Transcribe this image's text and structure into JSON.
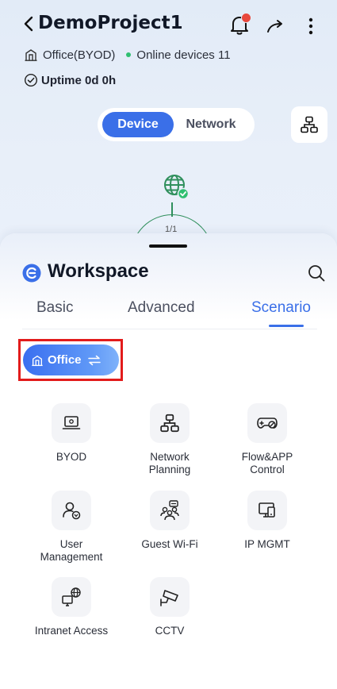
{
  "header": {
    "project_title": "DemoProject1",
    "site_name": "Office(BYOD)",
    "online_devices": "Online devices 11",
    "uptime": "Uptime 0d 0h"
  },
  "view_switch": {
    "device_label": "Device",
    "network_label": "Network",
    "selected": "Device"
  },
  "topology": {
    "page_count": "1/1"
  },
  "workspace": {
    "title": "Workspace",
    "tabs": [
      {
        "label": "Basic"
      },
      {
        "label": "Advanced"
      },
      {
        "label": "Scenario"
      }
    ],
    "active_tab": "Scenario",
    "scenario_selector": "Office",
    "features": [
      {
        "label": "BYOD",
        "icon": "byod-icon"
      },
      {
        "label": "Network\nPlanning",
        "icon": "network-planning-icon"
      },
      {
        "label": "Flow&APP\nControl",
        "icon": "flow-app-control-icon"
      },
      {
        "label": "User\nManagement",
        "icon": "user-management-icon"
      },
      {
        "label": "Guest Wi-Fi",
        "icon": "guest-wifi-icon"
      },
      {
        "label": "IP MGMT",
        "icon": "ip-mgmt-icon"
      },
      {
        "label": "Intranet Access",
        "icon": "intranet-access-icon"
      },
      {
        "label": "CCTV",
        "icon": "cctv-icon"
      }
    ]
  },
  "colors": {
    "accent": "#3a6fe8",
    "online": "#2fbf71",
    "badge": "#e8473c",
    "highlight_outline": "#e21b1b"
  }
}
